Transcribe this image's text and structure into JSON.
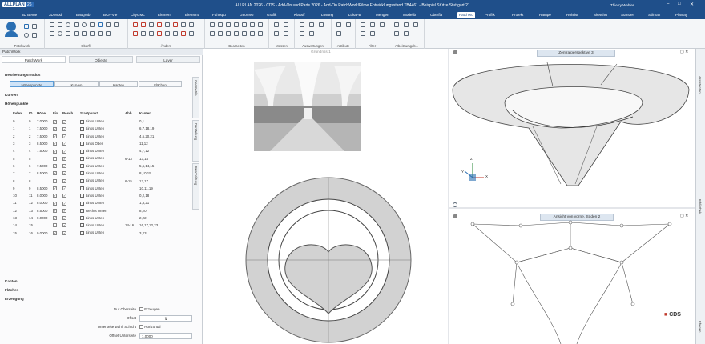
{
  "titlebar": {
    "app_logo": "ALLPLAN",
    "version": "26",
    "title": "ALLPLAN 2026 - CDS - Add-On und Parts 2026 - Add-On PatchWork/Filme Entwicklungsstand TB4461 - Beispiel Stütze Stuttgart 21",
    "user": "Thierry Wehler",
    "min": "–",
    "max": "□",
    "close": "✕"
  },
  "tabs": [
    "3D Beme",
    "3D Mod",
    "Baugrub",
    "BCF-Vie",
    "CityGML",
    "Element",
    "Element",
    "Fahrspu",
    "Geometr",
    "Grafik",
    "Klassif",
    "Lösung",
    "Lokal-B",
    "Mengen",
    "Modellb",
    "Oberflä",
    "Patchwo",
    "Profilk",
    "Projekt",
    "Rampe",
    "Rohrist",
    "SketchU",
    "Ständer",
    "Stilman",
    "Planlay"
  ],
  "active_tab_index": 16,
  "ribbon": {
    "groups": [
      "Patchwork",
      "Oberfl.",
      "Ändern",
      "Bearbeiten",
      "Messen",
      "Auswertungen",
      "Attribute",
      "Filter",
      "Arbeitsumgeb..."
    ]
  },
  "palette": {
    "header": "PatchWork",
    "tabs": [
      "PatchWork",
      "Objekte",
      "Layer"
    ],
    "side_tabs": [
      "Geometrie",
      "Darstellung",
      "Beschriftung"
    ],
    "sections": {
      "bearbeitungsmodus": "Bearbeitungsmodus",
      "kurven": "Kurven",
      "hoehenpunkte": "Höhenpunkte",
      "kanten": "Kanten",
      "flaechen": "Flächen",
      "erzeugung": "Erzeugung"
    },
    "modes": [
      "Höhenpunkte",
      "Kurven",
      "Kanten",
      "Flächen"
    ],
    "active_mode": 0,
    "table": {
      "headers": [
        "Index",
        "ID",
        "Höhe",
        "Fix",
        "Besch.",
        "Startpunkt",
        "Abh.",
        "Kanten"
      ],
      "rows": [
        [
          "0",
          "0",
          "7.0000",
          "✓",
          "✓",
          "Links Unten",
          "",
          "0,1"
        ],
        [
          "1",
          "1",
          "7.5000",
          "✓",
          "✓",
          "Links Unten",
          "",
          "6,7,18,19"
        ],
        [
          "2",
          "2",
          "7.5000",
          "✓",
          "✓",
          "Links Unten",
          "",
          "4,5,20,21"
        ],
        [
          "3",
          "3",
          "8.5000",
          "✓",
          "✓",
          "Links Oben",
          "",
          "11,12"
        ],
        [
          "4",
          "4",
          "7.5000",
          "✓",
          "✓",
          "Links Unten",
          "",
          "4,7,12"
        ],
        [
          "5",
          "5",
          "",
          "",
          "✓",
          "Links Unten",
          "6-13",
          "13,14"
        ],
        [
          "6",
          "6",
          "7.5000",
          "✓",
          "✓",
          "Links Unten",
          "",
          "5,6,14,15"
        ],
        [
          "7",
          "7",
          "8.5000",
          "✓",
          "✓",
          "Links Unten",
          "",
          "8,10,15"
        ],
        [
          "8",
          "8",
          "",
          "",
          "✓",
          "Links Unten",
          "6-15",
          "13,17"
        ],
        [
          "9",
          "9",
          "8.5000",
          "✓",
          "✓",
          "Links Unten",
          "",
          "10,11,19"
        ],
        [
          "10",
          "11",
          "8.0000",
          "✓",
          "✓",
          "Links Unten",
          "",
          "0,2,18"
        ],
        [
          "11",
          "12",
          "8.0000",
          "✓",
          "✓",
          "Links Unten",
          "",
          "1,3,21"
        ],
        [
          "12",
          "13",
          "8.5000",
          "✓",
          "✓",
          "Rechts Unten",
          "",
          "8,20"
        ],
        [
          "13",
          "14",
          "0.0000",
          "✓",
          "✓",
          "Links Unten",
          "",
          "2,22"
        ],
        [
          "14",
          "15",
          "",
          "",
          "✓",
          "Links Unten",
          "14-16",
          "16,17,22,23"
        ],
        [
          "15",
          "16",
          "0.0000",
          "✓",
          "✓",
          "Links Unten",
          "",
          "3,23"
        ]
      ]
    },
    "form": {
      "nur_oberseite_label": "Nur Oberseite",
      "nur_oberseite_value": "Erzeugen",
      "offset_label": "Offset",
      "unterseite_label": "Unterseite wählt Schicht",
      "unterseite_value": "Horizontal",
      "offset_unterseite_label": "Offset Unterseite",
      "offset_unterseite_value": "1.0000"
    }
  },
  "viewports": {
    "top_left_title": "Grundriss 1",
    "top_right_title": "Zentralperspektive 3",
    "bottom_right_title": "Ansicht von vorne, Süden 2",
    "axis_x": "X",
    "axis_y": "Y",
    "axis_z": "Z"
  },
  "right_sidebar": [
    "Assistenten",
    "Bibliothek",
    "Ebenen"
  ],
  "brand": "CDS",
  "colors": {
    "titlebar": "#1f4f8a",
    "accent": "#2a6fb3",
    "brand_red": "#c0392b"
  }
}
